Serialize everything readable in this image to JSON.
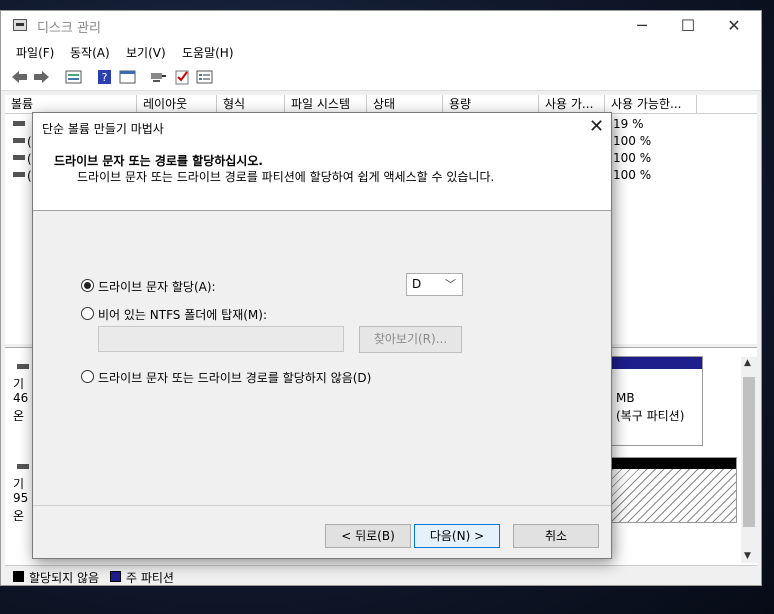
{
  "window": {
    "title": "디스크 관리",
    "minimize": "─",
    "maximize": "☐",
    "close": "✕"
  },
  "menu": [
    "파일(F)",
    "동작(A)",
    "보기(V)",
    "도움말(H)"
  ],
  "toolbar_icons": [
    "back-icon",
    "forward-icon",
    "properties-icon",
    "help-icon",
    "console-icon",
    "connect-icon",
    "check-icon",
    "list-icon"
  ],
  "volume_columns": [
    "볼륨",
    "레이아웃",
    "형식",
    "파일 시스템",
    "상태",
    "용량",
    "사용 가...",
    "사용 가능한..."
  ],
  "volume_rows": [
    {
      "name": "",
      "pct": "19 %"
    },
    {
      "name": "(",
      "pct": "100 %"
    },
    {
      "name": "(",
      "pct": "100 %"
    },
    {
      "name": "(",
      "pct": "100 %"
    }
  ],
  "disks": [
    {
      "l1": "기",
      "l2": "46",
      "l3": "온"
    },
    {
      "l1": "기",
      "l2": "95",
      "l3": "온"
    }
  ],
  "partition_top": {
    "size": "MB",
    "label": "(복구 파티션)"
  },
  "legend": {
    "unallocated": "할당되지 않음",
    "primary": "주 파티션"
  },
  "dialog": {
    "title": "단순 볼륨 만들기 마법사",
    "close": "✕",
    "heading": "드라이브 문자 또는 경로를 할당하십시오.",
    "subheading": "드라이브 문자 또는 드라이브 경로를 파티션에 할당하여 쉽게 액세스할 수 있습니다.",
    "option_assign": "드라이브 문자 할당(A):",
    "drive_letter": "D",
    "option_mount": "비어 있는 NTFS 폴더에 탑재(M):",
    "path_value": "",
    "browse": "찾아보기(R)...",
    "option_none": "드라이브 문자 또는 드라이브 경로를 할당하지 않음(D)",
    "back": "< 뒤로(B)",
    "next": "다음(N) >",
    "cancel": "취소"
  },
  "colors": {
    "primary_partition": "#1e1e8c",
    "unallocated": "#000000",
    "accent": "#0078d7"
  }
}
